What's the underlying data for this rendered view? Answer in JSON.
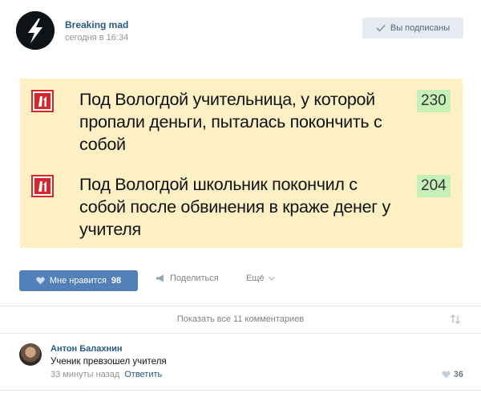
{
  "post": {
    "author": "Breaking mad",
    "time": "сегодня в 16:34",
    "subscribed_label": "Вы подписаны"
  },
  "news": [
    {
      "text": "Под Вологдой учительница, у которой пропали деньги, пыталась покончить с собой",
      "count": "230",
      "logo": "channel-logo-icon"
    },
    {
      "text": "Под Вологдой школьник покончил с собой после обвинения в краже денег у учителя",
      "count": "204",
      "logo": "channel-logo-icon"
    }
  ],
  "actions": {
    "like_label": "Мне нравится",
    "like_count": "98",
    "share_label": "Поделиться",
    "more_label": "Ещё"
  },
  "comments_section": {
    "show_all_label": "Показать все 11 комментариев"
  },
  "comment": {
    "author": "Антон Балахнин",
    "text": "Ученик превзошел учителя",
    "time": "33 минуты назад",
    "reply_label": "Ответить",
    "likes": "36"
  },
  "colors": {
    "link": "#2a5885",
    "like_button": "#5181b8",
    "card_background": "#fdf0c4",
    "count_background": "#c5f0b8",
    "logo_red": "#d8262b"
  }
}
